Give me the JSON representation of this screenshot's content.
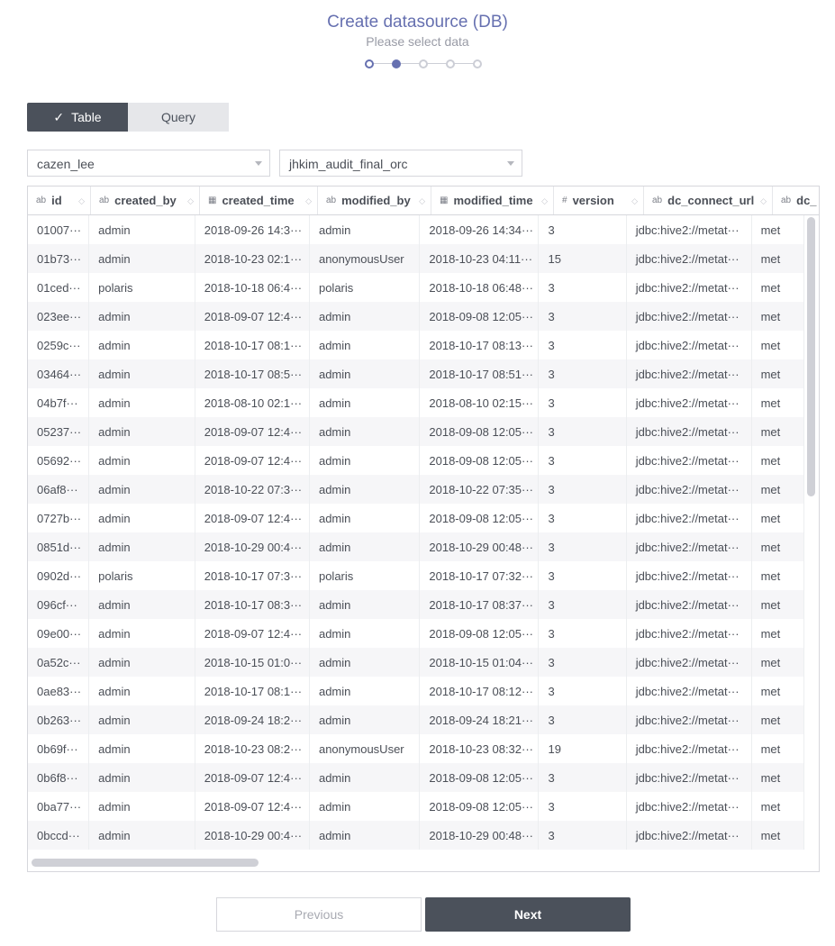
{
  "header": {
    "title": "Create datasource (DB)",
    "subtitle": "Please select data",
    "steps": {
      "total": 5,
      "current": 2
    }
  },
  "tabs": [
    {
      "label": "Table",
      "active": true,
      "icon": "check-icon"
    },
    {
      "label": "Query",
      "active": false
    }
  ],
  "selects": {
    "schema": "cazen_lee",
    "table": "jhkim_audit_final_orc"
  },
  "grid": {
    "columns": [
      {
        "name": "id",
        "type": "ab"
      },
      {
        "name": "created_by",
        "type": "ab"
      },
      {
        "name": "created_time",
        "type": "calendar"
      },
      {
        "name": "modified_by",
        "type": "ab"
      },
      {
        "name": "modified_time",
        "type": "calendar"
      },
      {
        "name": "version",
        "type": "#"
      },
      {
        "name": "dc_connect_url",
        "type": "ab"
      },
      {
        "name": "dc_",
        "type": "ab"
      }
    ],
    "rows": [
      [
        "01007···",
        "admin",
        "2018-09-26 14:3···",
        "admin",
        "2018-09-26 14:34···",
        "3",
        "jdbc:hive2://metat···",
        "met"
      ],
      [
        "01b73···",
        "admin",
        "2018-10-23 02:1···",
        "anonymousUser",
        "2018-10-23 04:11···",
        "15",
        "jdbc:hive2://metat···",
        "met"
      ],
      [
        "01ced···",
        "polaris",
        "2018-10-18 06:4···",
        "polaris",
        "2018-10-18 06:48···",
        "3",
        "jdbc:hive2://metat···",
        "met"
      ],
      [
        "023ee···",
        "admin",
        "2018-09-07 12:4···",
        "admin",
        "2018-09-08 12:05···",
        "3",
        "jdbc:hive2://metat···",
        "met"
      ],
      [
        "0259c···",
        "admin",
        "2018-10-17 08:1···",
        "admin",
        "2018-10-17 08:13···",
        "3",
        "jdbc:hive2://metat···",
        "met"
      ],
      [
        "03464···",
        "admin",
        "2018-10-17 08:5···",
        "admin",
        "2018-10-17 08:51···",
        "3",
        "jdbc:hive2://metat···",
        "met"
      ],
      [
        "04b7f···",
        "admin",
        "2018-08-10 02:1···",
        "admin",
        "2018-08-10 02:15···",
        "3",
        "jdbc:hive2://metat···",
        "met"
      ],
      [
        "05237···",
        "admin",
        "2018-09-07 12:4···",
        "admin",
        "2018-09-08 12:05···",
        "3",
        "jdbc:hive2://metat···",
        "met"
      ],
      [
        "05692···",
        "admin",
        "2018-09-07 12:4···",
        "admin",
        "2018-09-08 12:05···",
        "3",
        "jdbc:hive2://metat···",
        "met"
      ],
      [
        "06af8···",
        "admin",
        "2018-10-22 07:3···",
        "admin",
        "2018-10-22 07:35···",
        "3",
        "jdbc:hive2://metat···",
        "met"
      ],
      [
        "0727b···",
        "admin",
        "2018-09-07 12:4···",
        "admin",
        "2018-09-08 12:05···",
        "3",
        "jdbc:hive2://metat···",
        "met"
      ],
      [
        "0851d···",
        "admin",
        "2018-10-29 00:4···",
        "admin",
        "2018-10-29 00:48···",
        "3",
        "jdbc:hive2://metat···",
        "met"
      ],
      [
        "0902d···",
        "polaris",
        "2018-10-17 07:3···",
        "polaris",
        "2018-10-17 07:32···",
        "3",
        "jdbc:hive2://metat···",
        "met"
      ],
      [
        "096cf···",
        "admin",
        "2018-10-17 08:3···",
        "admin",
        "2018-10-17 08:37···",
        "3",
        "jdbc:hive2://metat···",
        "met"
      ],
      [
        "09e00···",
        "admin",
        "2018-09-07 12:4···",
        "admin",
        "2018-09-08 12:05···",
        "3",
        "jdbc:hive2://metat···",
        "met"
      ],
      [
        "0a52c···",
        "admin",
        "2018-10-15 01:0···",
        "admin",
        "2018-10-15 01:04···",
        "3",
        "jdbc:hive2://metat···",
        "met"
      ],
      [
        "0ae83···",
        "admin",
        "2018-10-17 08:1···",
        "admin",
        "2018-10-17 08:12···",
        "3",
        "jdbc:hive2://metat···",
        "met"
      ],
      [
        "0b263···",
        "admin",
        "2018-09-24 18:2···",
        "admin",
        "2018-09-24 18:21···",
        "3",
        "jdbc:hive2://metat···",
        "met"
      ],
      [
        "0b69f···",
        "admin",
        "2018-10-23 08:2···",
        "anonymousUser",
        "2018-10-23 08:32···",
        "19",
        "jdbc:hive2://metat···",
        "met"
      ],
      [
        "0b6f8···",
        "admin",
        "2018-09-07 12:4···",
        "admin",
        "2018-09-08 12:05···",
        "3",
        "jdbc:hive2://metat···",
        "met"
      ],
      [
        "0ba77···",
        "admin",
        "2018-09-07 12:4···",
        "admin",
        "2018-09-08 12:05···",
        "3",
        "jdbc:hive2://metat···",
        "met"
      ],
      [
        "0bccd···",
        "admin",
        "2018-10-29 00:4···",
        "admin",
        "2018-10-29 00:48···",
        "3",
        "jdbc:hive2://metat···",
        "met"
      ]
    ]
  },
  "footer": {
    "previous": "Previous",
    "next": "Next"
  },
  "colors": {
    "accent": "#6670b0",
    "dark": "#4b515b"
  }
}
